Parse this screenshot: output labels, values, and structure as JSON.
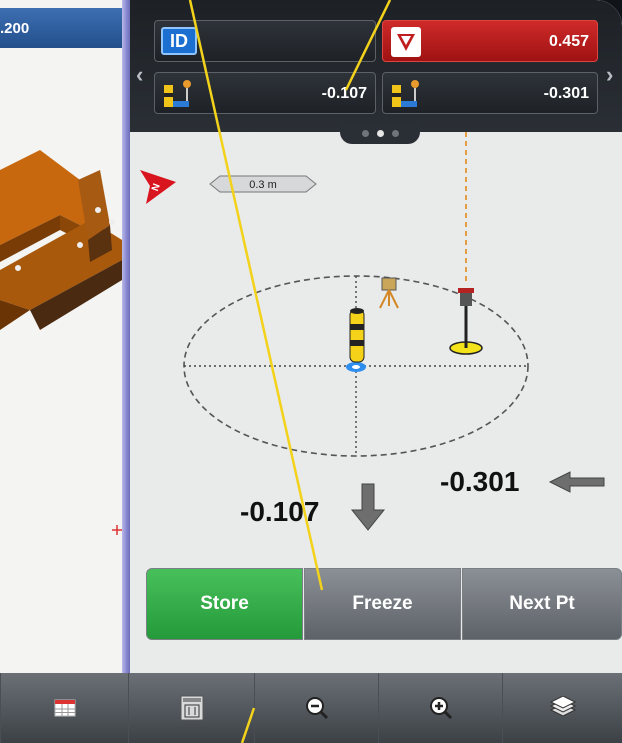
{
  "map": {
    "header_value": ".200"
  },
  "top_fields": {
    "id_label": "ID",
    "cut_fill": "0.457",
    "offset_left": "-0.107",
    "offset_right": "-0.301"
  },
  "scene": {
    "north_label": "N",
    "scale_label": "0.3 m",
    "right_offset": "-0.301",
    "down_offset": "-0.107"
  },
  "actions": {
    "store": "Store",
    "freeze": "Freeze",
    "next": "Next Pt"
  },
  "colors": {
    "store_green": "#2eaa46",
    "alert_red": "#c01e1e",
    "callout_yellow": "#f3d21b",
    "map_blue": "#2b5c9c"
  },
  "toolbar": {
    "icons": [
      "table-icon",
      "calculator-icon",
      "zoom-out-icon",
      "zoom-in-icon",
      "layers-icon"
    ]
  }
}
